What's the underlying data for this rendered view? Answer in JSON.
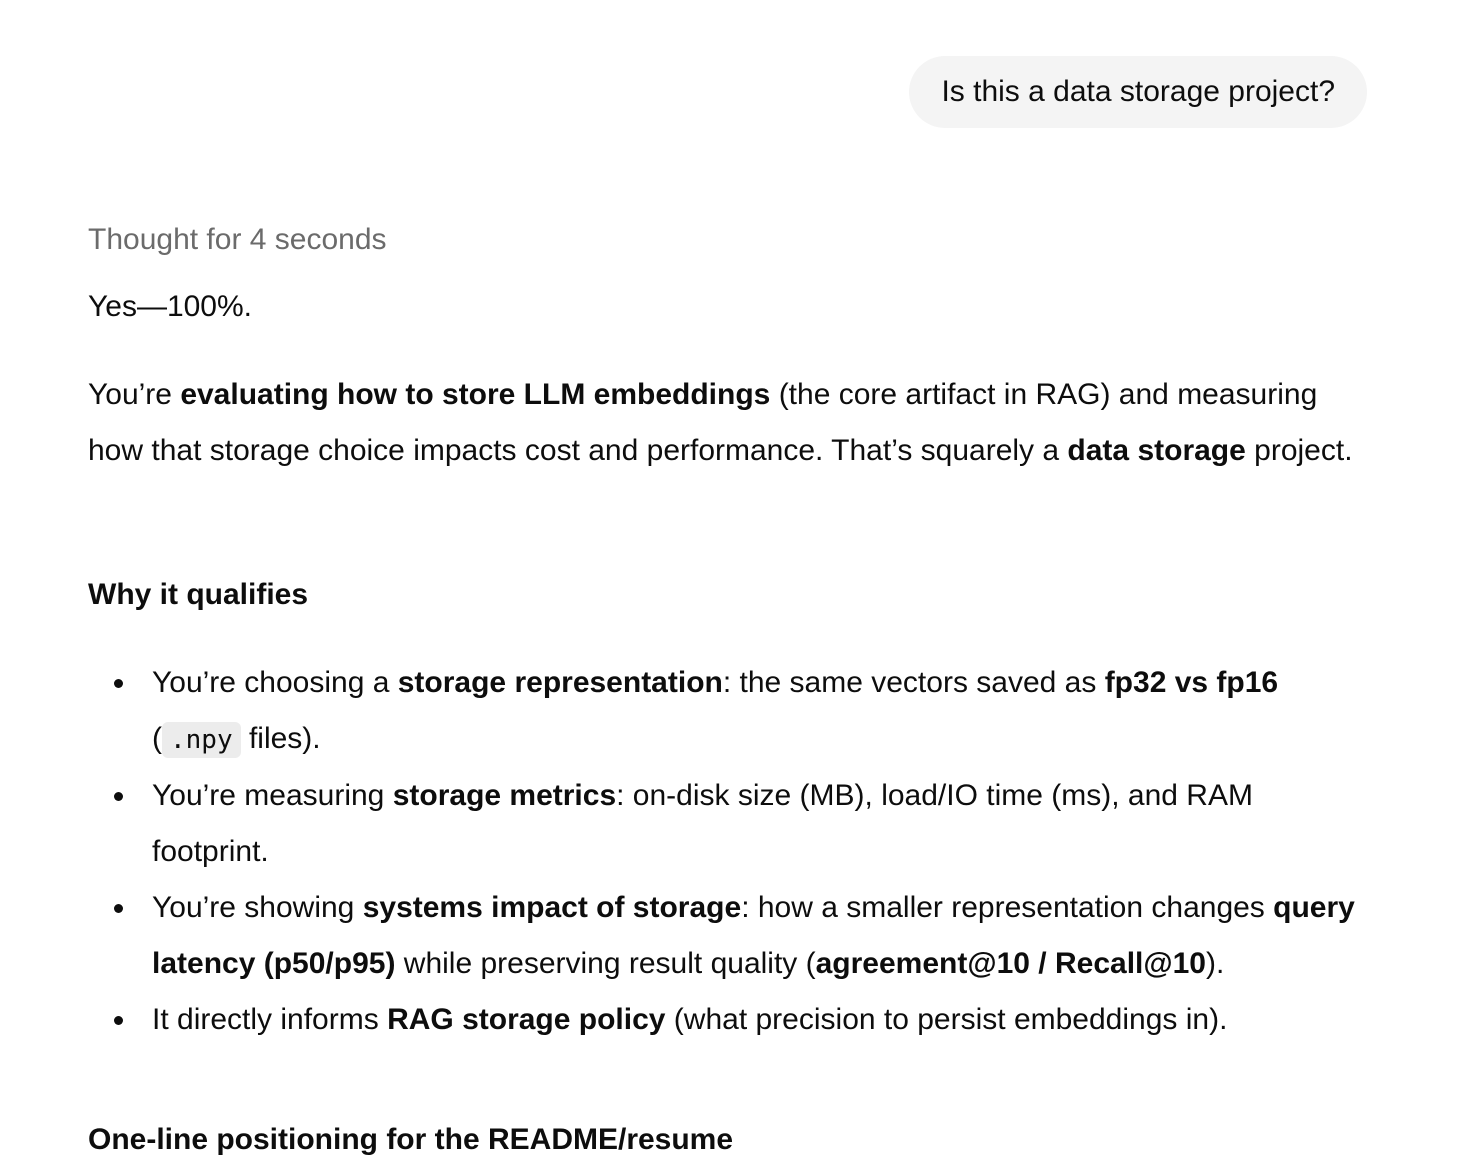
{
  "user_message": "Is this a data storage project?",
  "thought_label": "Thought for 4 seconds",
  "answer": {
    "yes": "Yes—100%.",
    "intro": {
      "t1": "You’re ",
      "b1": "evaluating how to store LLM embeddings",
      "t2": " (the core artifact in RAG) and measuring how that storage choice impacts cost and performance. That’s squarely a ",
      "b2": "data storage",
      "t3": " project."
    },
    "heading": "Why it qualifies",
    "bullets": [
      {
        "t1": "You’re choosing a ",
        "b1": "storage representation",
        "t2": ": the same vectors saved as ",
        "b2": "fp32 vs fp16",
        "t3": " (",
        "code": ".npy",
        "t4": " files)."
      },
      {
        "t1": "You’re measuring ",
        "b1": "storage metrics",
        "t2": ": on-disk size (MB), load/IO time (ms), and RAM footprint."
      },
      {
        "t1": "You’re showing ",
        "b1": "systems impact of storage",
        "t2": ": how a smaller representation changes ",
        "b2": "query latency (p50/p95)",
        "t3": " while preserving result quality (",
        "b3": "agreement@10 / Recall@10",
        "t4": ")."
      },
      {
        "t1": "It directly informs ",
        "b1": "RAG storage policy",
        "t2": " (what precision to persist embeddings in)."
      }
    ],
    "next_heading": "One-line positioning for the README/resume"
  }
}
